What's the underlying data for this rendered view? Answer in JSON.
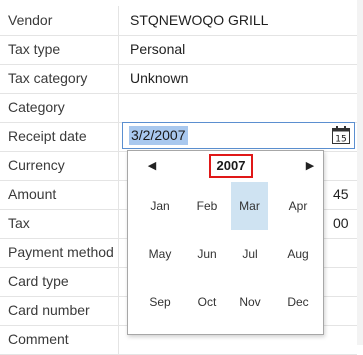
{
  "rows": [
    {
      "label": "Vendor",
      "value": "STQNEWOQO GRILL"
    },
    {
      "label": "Tax type",
      "value": "Personal"
    },
    {
      "label": "Tax category",
      "value": "Unknown"
    },
    {
      "label": "Category",
      "value": ""
    },
    {
      "label": "Receipt date",
      "value": "3/2/2007"
    },
    {
      "label": "Currency",
      "value": ""
    },
    {
      "label": "Amount",
      "value": ""
    },
    {
      "label": "Tax",
      "value": ""
    },
    {
      "label": "Payment method",
      "value": ""
    },
    {
      "label": "Card type",
      "value": ""
    },
    {
      "label": "Card number",
      "value": ""
    },
    {
      "label": "Comment",
      "value": ""
    }
  ],
  "calendar": {
    "year": "2007",
    "calendar_icon_day": "15",
    "months": [
      "Jan",
      "Feb",
      "Mar",
      "Apr",
      "May",
      "Jun",
      "Jul",
      "Aug",
      "Sep",
      "Oct",
      "Nov",
      "Dec"
    ],
    "selected_month": "Mar",
    "prev_glyph": "◀",
    "next_glyph": "▶"
  },
  "hidden_values": {
    "amount_tail": "45",
    "tax_tail": "00"
  },
  "colors": {
    "selection_highlight": "#a9c8ee",
    "selected_month": "#cfe3f2",
    "year_box_border": "#e01818",
    "field_focus_border": "#5b8fd0"
  }
}
